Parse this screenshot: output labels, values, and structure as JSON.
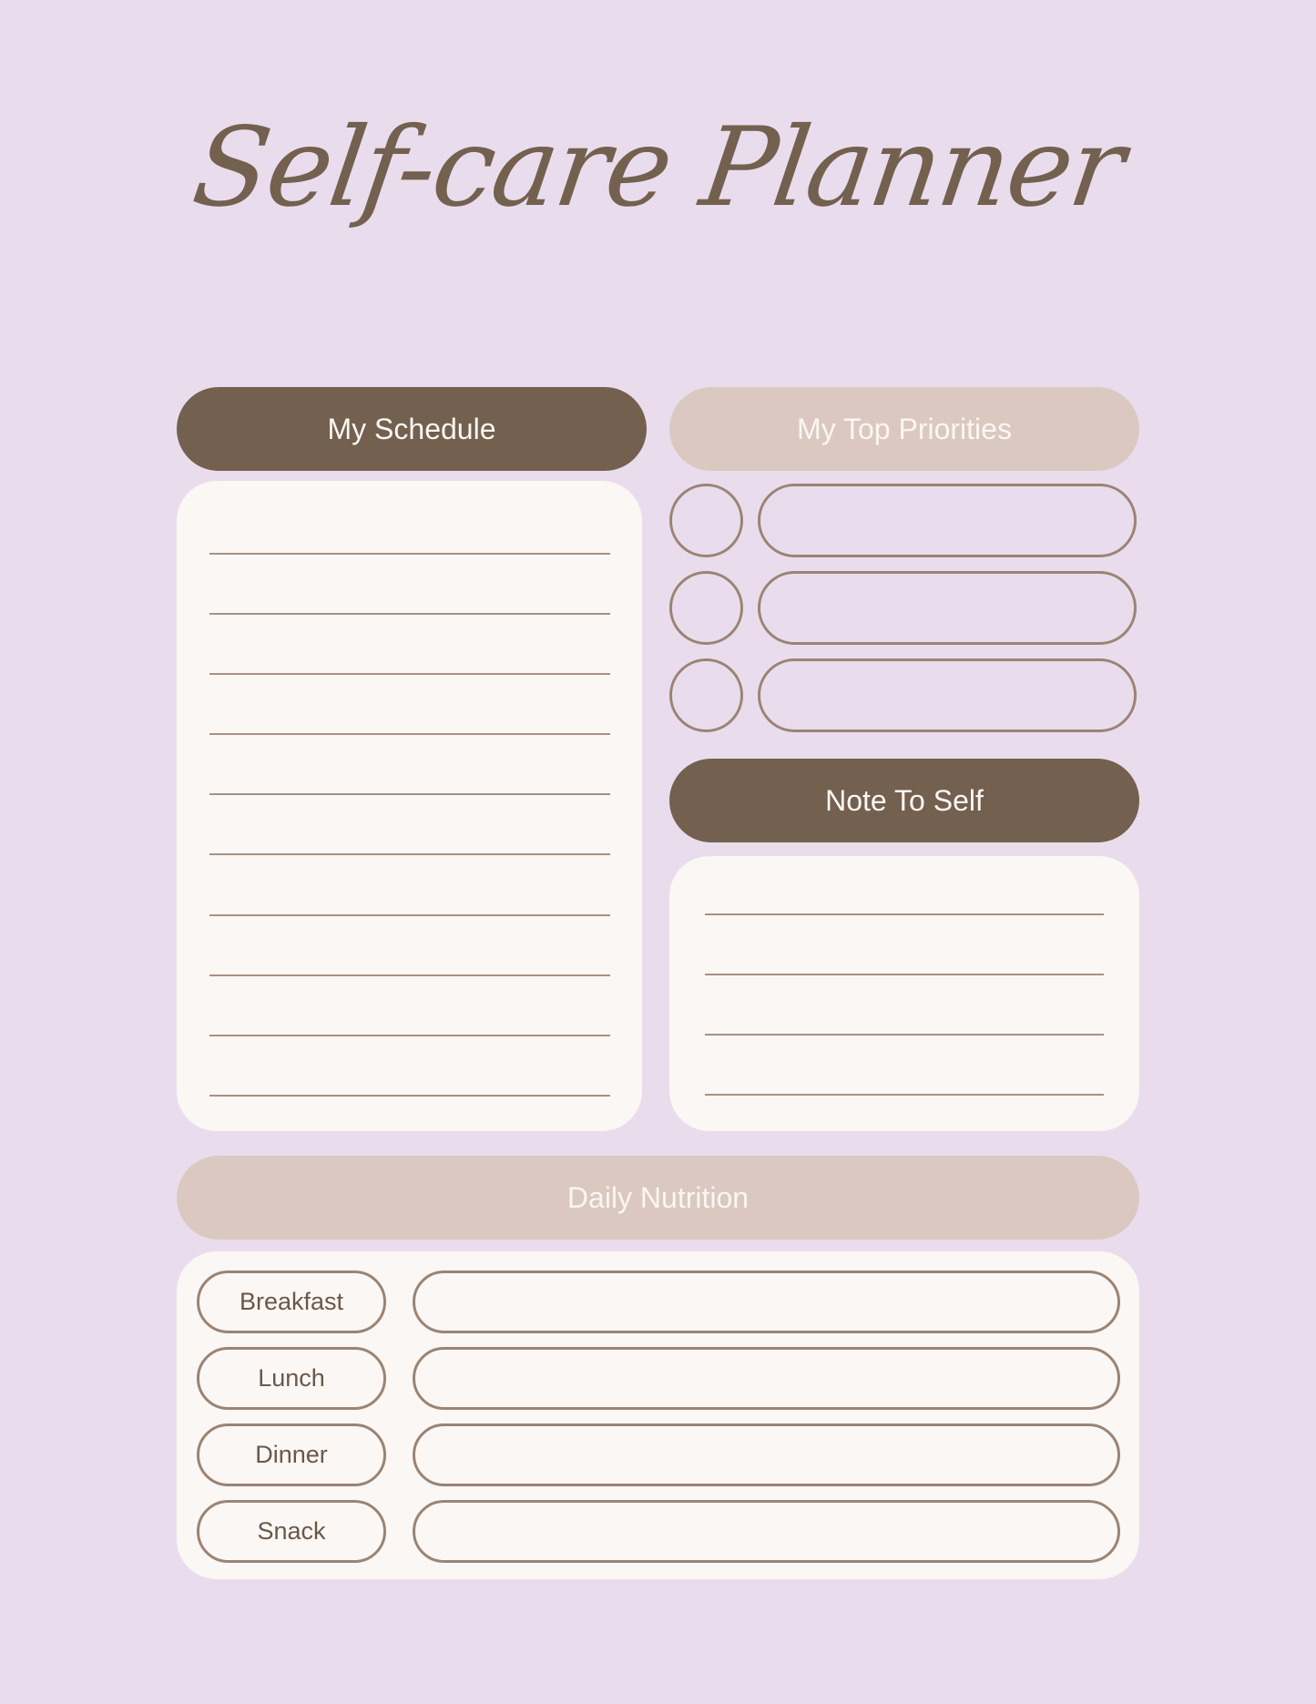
{
  "title": "Self-care Planner",
  "colors": {
    "background": "#e9dded",
    "dark_header": "#73604f",
    "light_header": "#dbc9c1",
    "card": "#fbf7f4",
    "outline": "#9b8473"
  },
  "schedule": {
    "header": "My Schedule",
    "line_count": 10
  },
  "priorities": {
    "header": "My Top Priorities",
    "items": [
      {
        "checked": false,
        "text": ""
      },
      {
        "checked": false,
        "text": ""
      },
      {
        "checked": false,
        "text": ""
      }
    ]
  },
  "note": {
    "header": "Note To Self",
    "line_count": 4
  },
  "nutrition": {
    "header": "Daily Nutrition",
    "meals": [
      {
        "label": "Breakfast",
        "value": ""
      },
      {
        "label": "Lunch",
        "value": ""
      },
      {
        "label": "Dinner",
        "value": ""
      },
      {
        "label": "Snack",
        "value": ""
      }
    ]
  }
}
